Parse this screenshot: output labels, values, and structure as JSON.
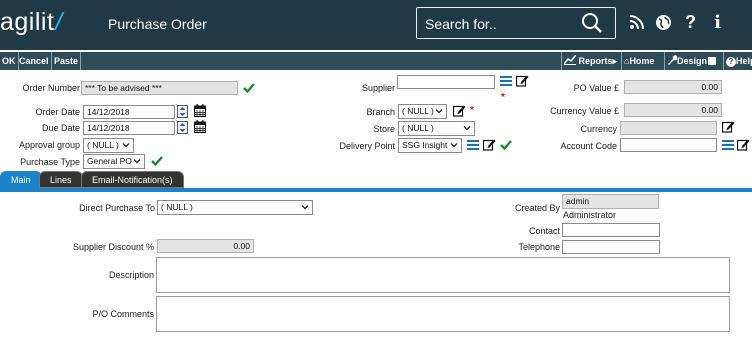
{
  "header": {
    "logo_text": "agilit",
    "logo_slash": "/",
    "title": "Purchase Order",
    "search_placeholder": "Search for..",
    "icons": [
      "rss-icon",
      "globe-icon",
      "help-icon",
      "info-icon"
    ]
  },
  "toolbar": {
    "ok": "OK",
    "cancel": "Cancel",
    "paste": "Paste",
    "reports": "Reports",
    "home": "Home",
    "design": "Design",
    "help": "Help"
  },
  "form": {
    "order_number": {
      "label": "Order Number",
      "value": "*** To be advised ***"
    },
    "order_date": {
      "label": "Order Date",
      "value": "14/12/2018"
    },
    "due_date": {
      "label": "Due Date",
      "value": "14/12/2018"
    },
    "approval_group": {
      "label": "Approval group",
      "value": "( NULL )"
    },
    "purchase_type": {
      "label": "Purchase Type",
      "value": "General PO"
    },
    "supplier": {
      "label": "Supplier",
      "value": ""
    },
    "branch": {
      "label": "Branch",
      "value": "( NULL )"
    },
    "store": {
      "label": "Store",
      "value": "( NULL )"
    },
    "delivery_point": {
      "label": "Delivery Point",
      "value": "SSG Insight"
    },
    "po_value": {
      "label": "PO Value",
      "currency_symbol": "£",
      "value": "0.00"
    },
    "currency_value": {
      "label": "Currency Value",
      "currency_symbol": "£",
      "value": "0.00"
    },
    "currency": {
      "label": "Currency",
      "value": ""
    },
    "account_code": {
      "label": "Account Code",
      "value": ""
    }
  },
  "tabs": [
    {
      "label": "Main",
      "active": true
    },
    {
      "label": "Lines",
      "active": false
    },
    {
      "label": "Email-Notification(s)",
      "active": false
    }
  ],
  "main": {
    "direct_purchase_to": {
      "label": "Direct Purchase To",
      "value": "( NULL )"
    },
    "supplier_discount": {
      "label": "Supplier Discount %",
      "value": "0.00"
    },
    "description": {
      "label": "Description",
      "value": ""
    },
    "po_comments": {
      "label": "P/O Comments",
      "value": ""
    },
    "created_by": {
      "label": "Created By",
      "value": "admin",
      "name": "Administrator"
    },
    "contact": {
      "label": "Contact",
      "value": ""
    },
    "telephone": {
      "label": "Telephone",
      "value": ""
    }
  },
  "colors": {
    "header_bg": "#203947",
    "toolbar_bg": "#2e4b5b",
    "accent": "#1a83c9",
    "tick": "#1a8a2a",
    "required": "#d01010"
  }
}
